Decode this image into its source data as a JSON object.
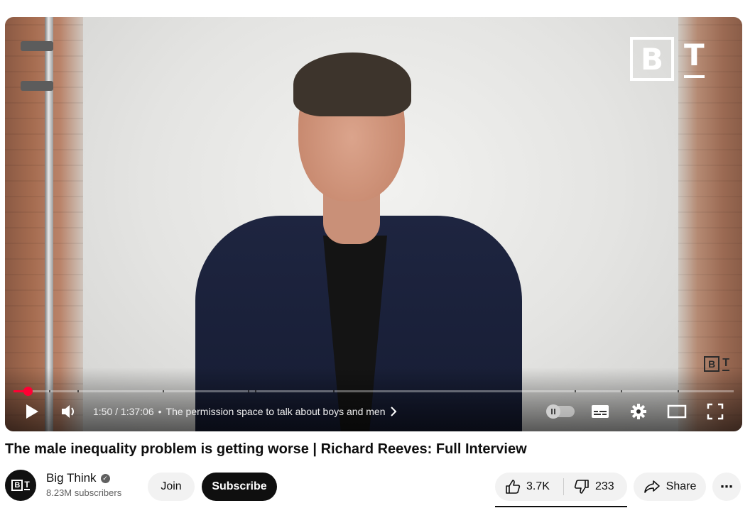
{
  "player": {
    "watermark": {
      "box_letter": "B",
      "side_letter": "T"
    },
    "corner_watermark": {
      "box_letter": "B",
      "side_letter": "T"
    },
    "progress": {
      "played_fraction": 0.02
    },
    "time": "1:50 / 1:37:06",
    "separator": "•",
    "chapter_title": "The permission space to talk about boys and men",
    "icons": {
      "play": "play-icon",
      "volume": "volume-icon",
      "chapter_arrow": "chevron-right-icon",
      "autoplay": "autoplay-toggle",
      "captions": "subtitles-icon",
      "settings": "gear-icon",
      "theater": "theater-mode-icon",
      "fullscreen": "fullscreen-icon"
    },
    "accent_color": "#ff0033"
  },
  "video": {
    "title": "The male inequality problem is getting worse | Richard Reeves: Full Interview"
  },
  "channel": {
    "avatar_box_letter": "B",
    "avatar_side_letter": "T",
    "name": "Big Think",
    "verified_icon": "verified-check-icon",
    "subscribers": "8.23M subscribers"
  },
  "actions": {
    "join_label": "Join",
    "subscribe_label": "Subscribe",
    "like_count": "3.7K",
    "dislike_count": "233",
    "share_label": "Share",
    "more_label": "⋯"
  }
}
